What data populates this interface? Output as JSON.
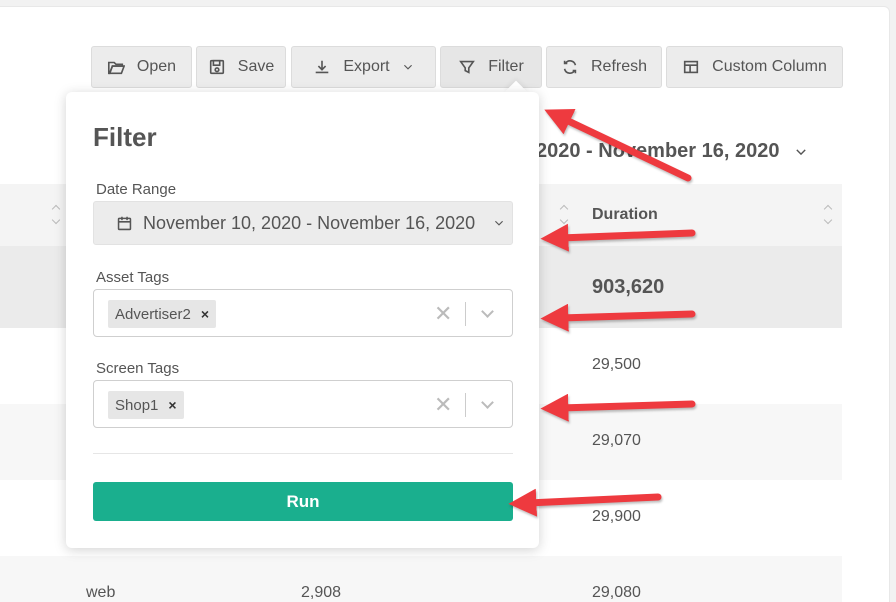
{
  "toolbar": {
    "open": "Open",
    "save": "Save",
    "export": "Export",
    "filter": "Filter",
    "refresh": "Refresh",
    "custom_column": "Custom Column"
  },
  "report": {
    "date_heading": "2020 - November 16, 2020",
    "column_duration": "Duration",
    "rows": [
      {
        "col1": "",
        "col2": "",
        "duration": "903,620"
      },
      {
        "col1": "",
        "col2": "",
        "duration": "29,500"
      },
      {
        "col1": "",
        "col2": "",
        "duration": "29,070"
      },
      {
        "col1": "",
        "col2": "",
        "duration": "29,900"
      },
      {
        "col1": "web",
        "col2": "2,908",
        "duration": "29,080"
      }
    ]
  },
  "filter_panel": {
    "title": "Filter",
    "date_range_label": "Date Range",
    "date_range_value": "November 10, 2020 - November 16, 2020",
    "asset_tags_label": "Asset Tags",
    "asset_tags": [
      "Advertiser2"
    ],
    "screen_tags_label": "Screen Tags",
    "screen_tags": [
      "Shop1"
    ],
    "run_label": "Run",
    "chip_remove": "×",
    "clear_symbol": "✕"
  },
  "colors": {
    "run_button": "#1aaf8e",
    "annotation_arrow": "#ee3a3f"
  }
}
